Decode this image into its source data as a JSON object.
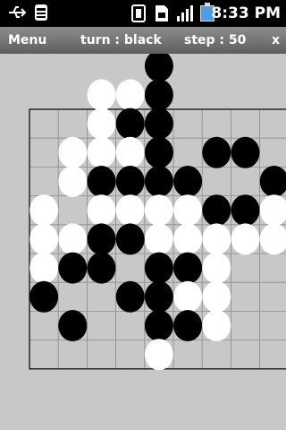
{
  "status": {
    "time": "8:33 PM",
    "icons": [
      "usb-icon",
      "android-debug-icon",
      "sim-icon",
      "sd-card-icon",
      "signal-icon",
      "battery-charging-icon"
    ]
  },
  "menubar": {
    "menu_label": "Menu",
    "turn_text": "turn : black",
    "step_text": "step : 50",
    "close_label": "x"
  },
  "board": {
    "grid_cols": 9,
    "grid_rows": 9,
    "stones": [
      {
        "c": "b",
        "col": 4,
        "row": -2
      },
      {
        "c": "w",
        "col": 2,
        "row": -1
      },
      {
        "c": "w",
        "col": 3,
        "row": -1
      },
      {
        "c": "b",
        "col": 4,
        "row": -1
      },
      {
        "c": "w",
        "col": 2,
        "row": 0
      },
      {
        "c": "b",
        "col": 3,
        "row": 0
      },
      {
        "c": "b",
        "col": 4,
        "row": 0
      },
      {
        "c": "w",
        "col": 1,
        "row": 1
      },
      {
        "c": "w",
        "col": 2,
        "row": 1
      },
      {
        "c": "w",
        "col": 3,
        "row": 1
      },
      {
        "c": "b",
        "col": 4,
        "row": 1
      },
      {
        "c": "b",
        "col": 6,
        "row": 1
      },
      {
        "c": "b",
        "col": 7,
        "row": 1
      },
      {
        "c": "w",
        "col": 1,
        "row": 2
      },
      {
        "c": "b",
        "col": 2,
        "row": 2
      },
      {
        "c": "b",
        "col": 3,
        "row": 2
      },
      {
        "c": "b",
        "col": 4,
        "row": 2
      },
      {
        "c": "b",
        "col": 5,
        "row": 2
      },
      {
        "c": "b",
        "col": 8,
        "row": 2
      },
      {
        "c": "w",
        "col": 0,
        "row": 3
      },
      {
        "c": "w",
        "col": 2,
        "row": 3
      },
      {
        "c": "w",
        "col": 3,
        "row": 3
      },
      {
        "c": "w",
        "col": 4,
        "row": 3
      },
      {
        "c": "w",
        "col": 5,
        "row": 3
      },
      {
        "c": "b",
        "col": 6,
        "row": 3
      },
      {
        "c": "b",
        "col": 7,
        "row": 3
      },
      {
        "c": "w",
        "col": 8,
        "row": 3
      },
      {
        "c": "w",
        "col": 0,
        "row": 4
      },
      {
        "c": "w",
        "col": 1,
        "row": 4
      },
      {
        "c": "b",
        "col": 2,
        "row": 4
      },
      {
        "c": "b",
        "col": 3,
        "row": 4
      },
      {
        "c": "w",
        "col": 4,
        "row": 4
      },
      {
        "c": "w",
        "col": 5,
        "row": 4
      },
      {
        "c": "w",
        "col": 6,
        "row": 4
      },
      {
        "c": "w",
        "col": 7,
        "row": 4
      },
      {
        "c": "w",
        "col": 8,
        "row": 4
      },
      {
        "c": "w",
        "col": 0,
        "row": 5
      },
      {
        "c": "b",
        "col": 1,
        "row": 5
      },
      {
        "c": "b",
        "col": 2,
        "row": 5
      },
      {
        "c": "b",
        "col": 4,
        "row": 5
      },
      {
        "c": "b",
        "col": 5,
        "row": 5
      },
      {
        "c": "w",
        "col": 6,
        "row": 5
      },
      {
        "c": "b",
        "col": 0,
        "row": 6
      },
      {
        "c": "b",
        "col": 3,
        "row": 6
      },
      {
        "c": "b",
        "col": 4,
        "row": 6
      },
      {
        "c": "w",
        "col": 5,
        "row": 6
      },
      {
        "c": "w",
        "col": 6,
        "row": 6
      },
      {
        "c": "b",
        "col": 1,
        "row": 7
      },
      {
        "c": "b",
        "col": 4,
        "row": 7
      },
      {
        "c": "b",
        "col": 5,
        "row": 7
      },
      {
        "c": "w",
        "col": 6,
        "row": 7
      },
      {
        "c": "w",
        "col": 4,
        "row": 8
      }
    ]
  }
}
